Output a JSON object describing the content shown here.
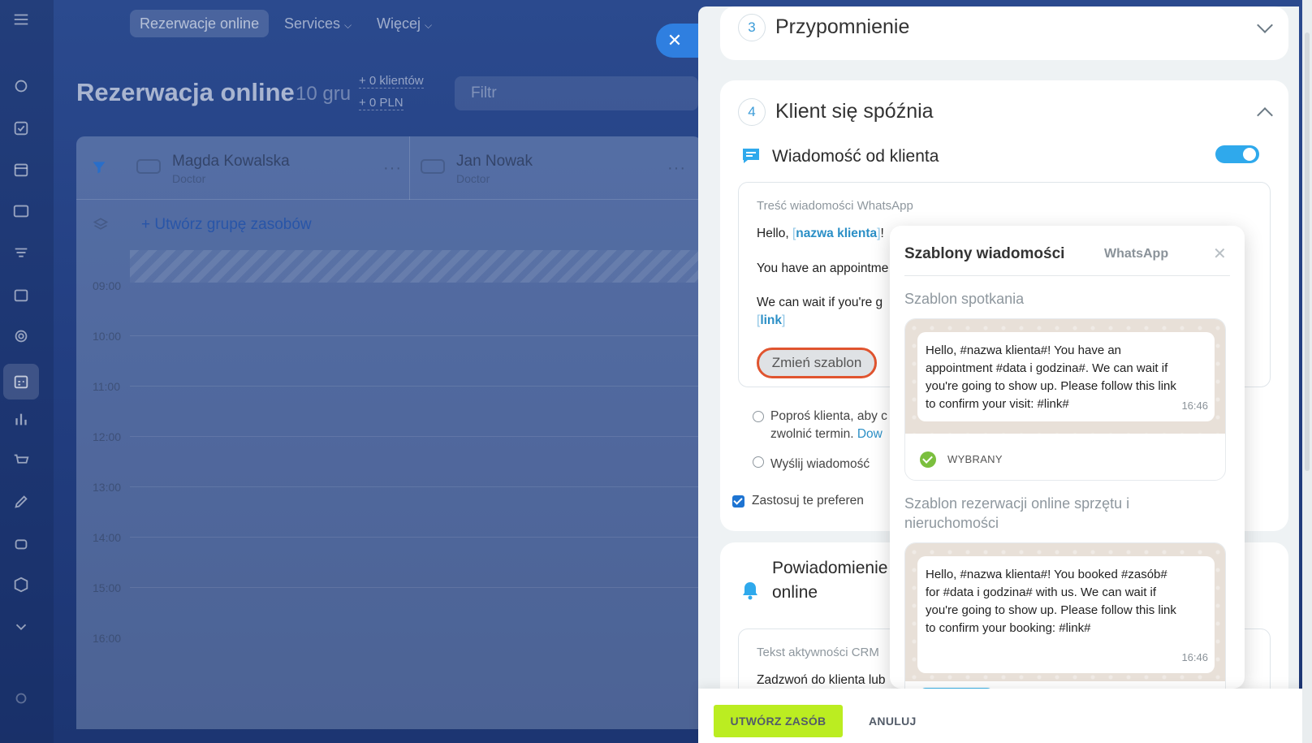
{
  "topnav": {
    "active": "Rezerwacje online",
    "services": "Services",
    "more": "Więcej"
  },
  "page": {
    "title": "Rezerwacja online",
    "date": "10 gru",
    "clients": "+ 0 klientów",
    "amount": "+ 0 PLN",
    "filter_placeholder": "Filtr"
  },
  "grid": {
    "resources": [
      {
        "name": "Magda Kowalska",
        "role": "Doctor"
      },
      {
        "name": "Jan Nowak",
        "role": "Doctor"
      }
    ],
    "create_group": "Utwórz grupę zasobów",
    "hours": [
      "09:00",
      "10:00",
      "11:00",
      "12:00",
      "13:00",
      "14:00",
      "15:00",
      "16:00"
    ]
  },
  "panel": {
    "step3": {
      "num": "3",
      "title": "Przypomnienie"
    },
    "step4": {
      "num": "4",
      "title": "Klient się spóźnia"
    },
    "client_message": {
      "label": "Wiadomość od klienta",
      "toggle_on": true,
      "box_label": "Treść wiadomości WhatsApp",
      "line1_pre": "Hello, ",
      "line1_var": "nazwa klienta",
      "line1_post": "!",
      "line2": "You have an appointme",
      "line3": "We can wait if you're g",
      "line4_var": "link",
      "change_button": "Zmień szablon"
    },
    "hint_line1": "Poproś klienta, aby c",
    "hint_line2_pre": "zwolnić termin. ",
    "hint_line2_link": "Dow",
    "send_label": "Wyślij wiadomość",
    "apply_label": "Zastosuj te preferen",
    "notification": {
      "title_line1": "Powiadomienie",
      "title_line2": "online",
      "crm_label": "Tekst aktywności CRM",
      "crm_text": "Zadzwoń do klienta lub"
    }
  },
  "templates": {
    "title": "Szablony wiadomości",
    "channel": "WhatsApp",
    "section1": "Szablon spotkania",
    "card1_text": "Hello, #nazwa klienta#! You have an appointment #data i godzina#. We can wait if you're going to show up. Please follow this link to confirm your visit: #link#",
    "card1_time": "16:46",
    "selected": "WYBRANY",
    "section2": "Szablon rezerwacji online sprzętu i nieruchomości",
    "card2_text": "Hello, #nazwa klienta#! You booked #zasób# for #data i godzina# with us. We can wait if you're going to show up. Please follow this link to confirm your booking: #link#",
    "card2_time": "16:46"
  },
  "footer": {
    "create": "UTWÓRZ ZASÓB",
    "cancel": "ANULUJ"
  },
  "colors": {
    "accent": "#2fa9ec",
    "create_button": "#bbed21",
    "highlight_ring": "#e0542f",
    "selected_check": "#7bbf3e"
  }
}
